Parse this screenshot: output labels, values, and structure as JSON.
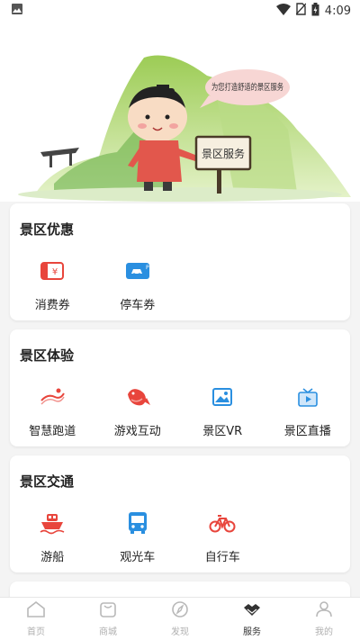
{
  "status_bar": {
    "time": "4:09"
  },
  "banner": {
    "speech_bubble": "为您打造舒适的景区服务",
    "sign_text": "景区服务"
  },
  "sections": [
    {
      "title": "景区优惠",
      "items": [
        {
          "label": "消费券",
          "icon": "voucher-icon"
        },
        {
          "label": "停车券",
          "icon": "parking-coupon-icon"
        }
      ]
    },
    {
      "title": "景区体验",
      "items": [
        {
          "label": "智慧跑道",
          "icon": "running-track-icon"
        },
        {
          "label": "游戏互动",
          "icon": "game-koi-icon"
        },
        {
          "label": "景区VR",
          "icon": "vr-picture-icon"
        },
        {
          "label": "景区直播",
          "icon": "live-tv-icon"
        }
      ]
    },
    {
      "title": "景区交通",
      "items": [
        {
          "label": "游船",
          "icon": "boat-icon"
        },
        {
          "label": "观光车",
          "icon": "bus-icon"
        },
        {
          "label": "自行车",
          "icon": "bicycle-icon"
        }
      ]
    }
  ],
  "tabbar": {
    "items": [
      {
        "label": "首页",
        "icon": "home-icon"
      },
      {
        "label": "商城",
        "icon": "shop-bag-icon"
      },
      {
        "label": "发现",
        "icon": "compass-icon"
      },
      {
        "label": "服务",
        "icon": "handshake-icon",
        "active": true
      },
      {
        "label": "我的",
        "icon": "user-icon"
      }
    ]
  },
  "colors": {
    "accent_red": "#e8453c",
    "accent_blue": "#2a8fe0",
    "card_bg": "#ffffff",
    "page_bg": "#f4f4f4"
  }
}
